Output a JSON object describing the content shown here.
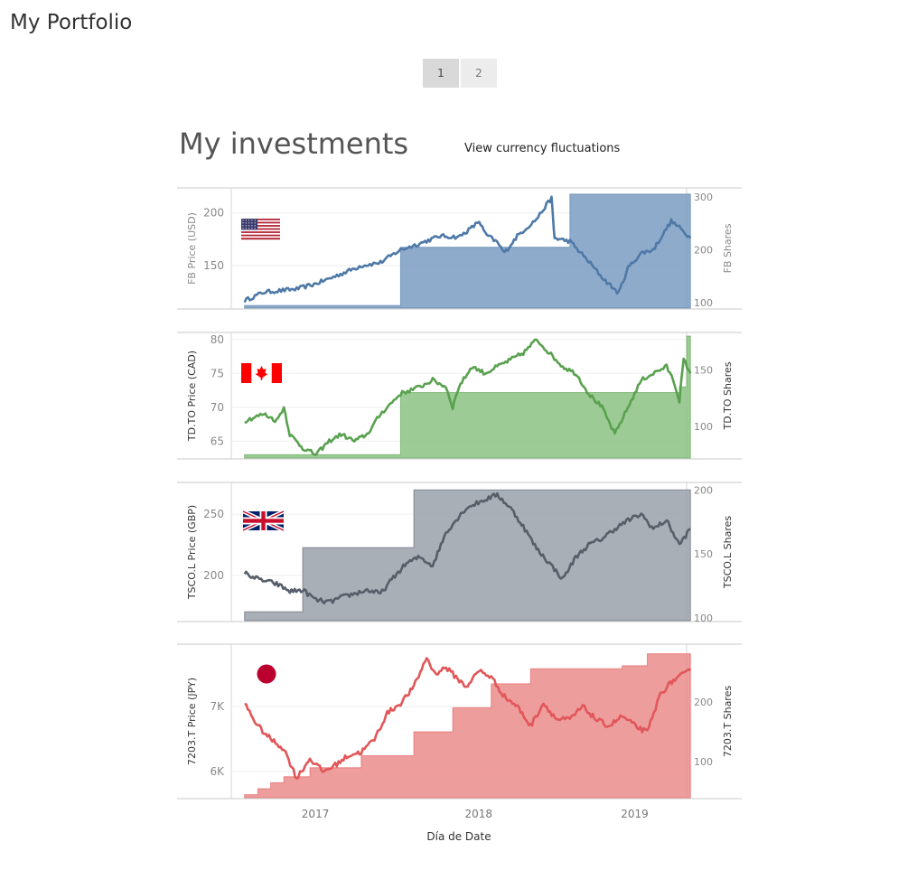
{
  "app": {
    "title": "My Portfolio"
  },
  "tabs": [
    {
      "label": "1",
      "active": true
    },
    {
      "label": "2",
      "active": false
    }
  ],
  "dashboard": {
    "title": "My investments",
    "currency_link": "View currency fluctuations"
  },
  "x_axis": {
    "label": "Día de Date",
    "ticks": [
      "2017",
      "2018",
      "2019"
    ],
    "range": [
      "2016-07",
      "2019-06"
    ]
  },
  "flags": [
    {
      "country": "United States",
      "icon": "us-flag-icon"
    },
    {
      "country": "Canada",
      "icon": "canada-flag-icon"
    },
    {
      "country": "United Kingdom",
      "icon": "uk-flag-icon"
    },
    {
      "country": "Japan",
      "icon": "japan-flag-icon"
    }
  ],
  "chart_data": [
    {
      "type": "line",
      "ticker": "FB",
      "color": "#4e79a7",
      "share_color": "#7b9cc2",
      "ylabel": "FB Price (USD)",
      "ylabel2": "FB Shares",
      "yticks": [
        "200",
        "150"
      ],
      "y2ticks": [
        "300",
        "200",
        "100"
      ],
      "y_range": [
        110,
        220
      ],
      "y2_range": [
        90,
        310
      ],
      "price_keys": [
        [
          "2016-08-01",
          117
        ],
        [
          "2016-09-15",
          125
        ],
        [
          "2016-12-01",
          128
        ],
        [
          "2017-01-15",
          133
        ],
        [
          "2017-03-01",
          140
        ],
        [
          "2017-05-01",
          150
        ],
        [
          "2017-06-15",
          153
        ],
        [
          "2017-08-01",
          165
        ],
        [
          "2017-09-15",
          171
        ],
        [
          "2017-11-01",
          178
        ],
        [
          "2017-12-15",
          177
        ],
        [
          "2018-01-15",
          186
        ],
        [
          "2018-02-01",
          192
        ],
        [
          "2018-02-15",
          180
        ],
        [
          "2018-03-15",
          172
        ],
        [
          "2018-04-01",
          162
        ],
        [
          "2018-05-01",
          178
        ],
        [
          "2018-06-15",
          194
        ],
        [
          "2018-07-20",
          214
        ],
        [
          "2018-07-27",
          176
        ],
        [
          "2018-09-01",
          173
        ],
        [
          "2018-10-15",
          154
        ],
        [
          "2018-11-15",
          139
        ],
        [
          "2018-12-24",
          124
        ],
        [
          "2019-01-15",
          148
        ],
        [
          "2019-02-15",
          162
        ],
        [
          "2019-03-15",
          165
        ],
        [
          "2019-04-26",
          192
        ],
        [
          "2019-05-15",
          186
        ],
        [
          "2019-06-10",
          176
        ]
      ],
      "shares": [
        [
          "2016-08-01",
          95
        ],
        [
          "2017-08-01",
          205
        ],
        [
          "2018-09-01",
          305
        ]
      ],
      "end": "2019-06-10"
    },
    {
      "type": "line",
      "ticker": "TD.TO",
      "color": "#59a14f",
      "share_color": "#8cc283",
      "ylabel": "TD.TO Price (CAD)",
      "ylabel2": "TD.TO Shares",
      "yticks": [
        "80",
        "75",
        "70",
        "65"
      ],
      "y2ticks": [
        "150",
        "100"
      ],
      "y_range": [
        62.5,
        80.5
      ],
      "y2_range": [
        72,
        180
      ],
      "price_keys": [
        [
          "2016-08-01",
          68
        ],
        [
          "2016-09-15",
          69
        ],
        [
          "2016-10-15",
          68
        ],
        [
          "2016-11-01",
          70
        ],
        [
          "2016-11-15",
          66
        ],
        [
          "2016-12-15",
          64
        ],
        [
          "2017-01-15",
          63
        ],
        [
          "2017-02-15",
          65
        ],
        [
          "2017-03-15",
          66
        ],
        [
          "2017-04-15",
          65
        ],
        [
          "2017-05-15",
          66
        ],
        [
          "2017-06-15",
          69
        ],
        [
          "2017-08-01",
          72
        ],
        [
          "2017-09-15",
          73
        ],
        [
          "2017-10-15",
          74
        ],
        [
          "2017-11-15",
          73
        ],
        [
          "2017-12-01",
          70
        ],
        [
          "2017-12-15",
          73
        ],
        [
          "2018-01-15",
          76
        ],
        [
          "2018-02-15",
          75
        ],
        [
          "2018-03-15",
          76
        ],
        [
          "2018-04-15",
          77
        ],
        [
          "2018-05-15",
          78
        ],
        [
          "2018-06-15",
          80
        ],
        [
          "2018-07-15",
          78
        ],
        [
          "2018-08-15",
          76
        ],
        [
          "2018-09-15",
          75
        ],
        [
          "2018-10-15",
          72
        ],
        [
          "2018-11-15",
          70
        ],
        [
          "2018-12-15",
          66
        ],
        [
          "2019-01-15",
          70
        ],
        [
          "2019-02-15",
          74
        ],
        [
          "2019-03-15",
          75
        ],
        [
          "2019-04-15",
          76
        ],
        [
          "2019-05-01",
          74
        ],
        [
          "2019-05-15",
          71
        ],
        [
          "2019-05-25",
          77
        ],
        [
          "2019-06-10",
          75
        ]
      ],
      "shares": [
        [
          "2016-08-01",
          75
        ],
        [
          "2017-08-01",
          130
        ],
        [
          "2019-05-15",
          135
        ],
        [
          "2019-06-01",
          180
        ]
      ],
      "end": "2019-06-10"
    },
    {
      "type": "line",
      "ticker": "TSCO.L",
      "color": "#555e69",
      "share_color": "#9aa1aa",
      "ylabel": "TSCO.L Price (GBP)",
      "ylabel2": "TSCO.L Shares",
      "yticks": [
        "250",
        "200"
      ],
      "y2ticks": [
        "200",
        "150",
        "100"
      ],
      "y_range": [
        163,
        273
      ],
      "y2_range": [
        98,
        203
      ],
      "price_keys": [
        [
          "2016-08-01",
          202
        ],
        [
          "2016-09-01",
          197
        ],
        [
          "2016-10-15",
          193
        ],
        [
          "2016-11-15",
          187
        ],
        [
          "2016-12-15",
          188
        ],
        [
          "2017-01-15",
          180
        ],
        [
          "2017-02-15",
          178
        ],
        [
          "2017-03-15",
          182
        ],
        [
          "2017-04-15",
          185
        ],
        [
          "2017-05-15",
          188
        ],
        [
          "2017-06-15",
          185
        ],
        [
          "2017-07-15",
          198
        ],
        [
          "2017-08-15",
          210
        ],
        [
          "2017-09-15",
          215
        ],
        [
          "2017-10-15",
          208
        ],
        [
          "2017-11-15",
          235
        ],
        [
          "2018-01-01",
          255
        ],
        [
          "2018-02-15",
          262
        ],
        [
          "2018-03-15",
          266
        ],
        [
          "2018-04-15",
          255
        ],
        [
          "2018-05-15",
          240
        ],
        [
          "2018-06-15",
          222
        ],
        [
          "2018-07-15",
          210
        ],
        [
          "2018-08-15",
          197
        ],
        [
          "2018-09-15",
          215
        ],
        [
          "2018-10-15",
          225
        ],
        [
          "2018-11-15",
          230
        ],
        [
          "2018-12-15",
          238
        ],
        [
          "2019-01-15",
          245
        ],
        [
          "2019-02-15",
          250
        ],
        [
          "2019-03-15",
          238
        ],
        [
          "2019-04-15",
          245
        ],
        [
          "2019-05-15",
          225
        ],
        [
          "2019-06-10",
          238
        ]
      ],
      "shares": [
        [
          "2016-08-01",
          105
        ],
        [
          "2016-12-15",
          155
        ],
        [
          "2017-09-01",
          200
        ]
      ],
      "end": "2019-06-10"
    },
    {
      "type": "line",
      "ticker": "7203.T",
      "color": "#e15759",
      "share_color": "#eb8c8c",
      "ylabel": "7203.T Price (JPY)",
      "ylabel2": "7203.T Shares",
      "yticks": [
        "7K",
        "6K"
      ],
      "y2ticks": [
        "200",
        "100"
      ],
      "y_range": [
        5600,
        7900
      ],
      "y2_range": [
        40,
        290
      ],
      "price_keys": [
        [
          "2016-08-01",
          7050
        ],
        [
          "2016-09-01",
          6700
        ],
        [
          "2016-10-01",
          6500
        ],
        [
          "2016-11-01",
          6350
        ],
        [
          "2016-12-01",
          5900
        ],
        [
          "2017-01-01",
          6200
        ],
        [
          "2017-02-01",
          6000
        ],
        [
          "2017-03-01",
          6100
        ],
        [
          "2017-04-01",
          6250
        ],
        [
          "2017-05-01",
          6300
        ],
        [
          "2017-06-01",
          6500
        ],
        [
          "2017-07-01",
          6900
        ],
        [
          "2017-08-01",
          7050
        ],
        [
          "2017-09-01",
          7300
        ],
        [
          "2017-10-01",
          7750
        ],
        [
          "2017-10-20",
          7500
        ],
        [
          "2017-11-15",
          7600
        ],
        [
          "2018-01-01",
          7300
        ],
        [
          "2018-02-01",
          7550
        ],
        [
          "2018-03-01",
          7450
        ],
        [
          "2018-04-01",
          7150
        ],
        [
          "2018-05-01",
          7000
        ],
        [
          "2018-06-01",
          6700
        ],
        [
          "2018-07-01",
          7050
        ],
        [
          "2018-08-01",
          6800
        ],
        [
          "2018-09-01",
          6800
        ],
        [
          "2018-10-01",
          7000
        ],
        [
          "2018-11-01",
          6800
        ],
        [
          "2018-12-01",
          6700
        ],
        [
          "2019-01-01",
          6850
        ],
        [
          "2019-02-01",
          6700
        ],
        [
          "2019-03-01",
          6600
        ],
        [
          "2019-04-01",
          7200
        ],
        [
          "2019-05-01",
          7400
        ],
        [
          "2019-06-10",
          7550
        ]
      ],
      "shares": [
        [
          "2016-08-01",
          45
        ],
        [
          "2016-09-01",
          55
        ],
        [
          "2016-10-01",
          65
        ],
        [
          "2016-11-01",
          75
        ],
        [
          "2017-01-01",
          90
        ],
        [
          "2017-05-01",
          110
        ],
        [
          "2017-09-01",
          150
        ],
        [
          "2017-12-01",
          190
        ],
        [
          "2018-03-01",
          230
        ],
        [
          "2018-06-01",
          255
        ],
        [
          "2019-01-01",
          260
        ],
        [
          "2019-03-01",
          280
        ]
      ],
      "end": "2019-06-10"
    }
  ]
}
